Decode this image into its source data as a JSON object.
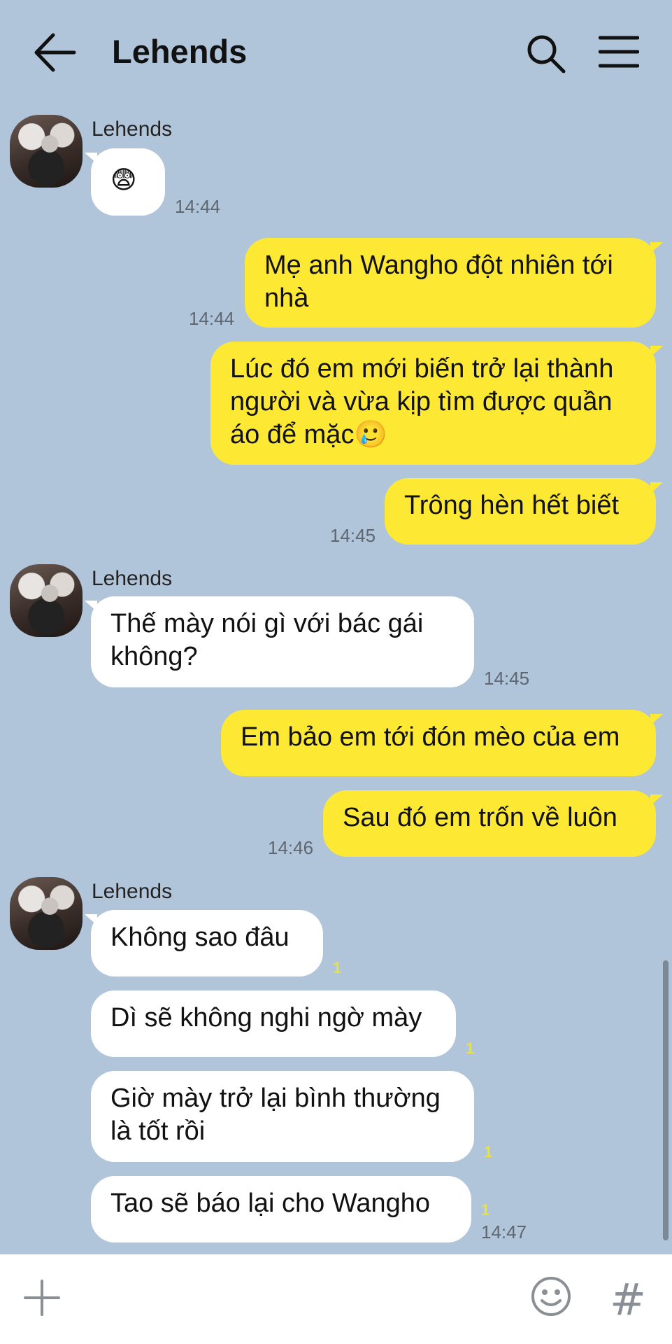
{
  "header": {
    "title": "Lehends",
    "back_icon": "arrow-left-icon",
    "search_icon": "search-icon",
    "menu_icon": "menu-icon"
  },
  "messages": [
    {
      "sender": "Lehends",
      "text": "😨",
      "time": "14:44"
    },
    {
      "text": "Mẹ anh Wangho đột nhiên tới nhà",
      "time": "14:44"
    },
    {
      "text": "Lúc đó em mới biến trở lại thành người và vừa kịp tìm được quần áo để mặc🥲"
    },
    {
      "text": "Trông hèn hết biết",
      "time": "14:45"
    },
    {
      "sender": "Lehends",
      "text": "Thế mày nói gì với bác gái không?",
      "time": "14:45"
    },
    {
      "text": "Em bảo em tới đón mèo của em"
    },
    {
      "text": "Sau đó em trốn về luôn",
      "time": "14:46"
    },
    {
      "sender": "Lehends",
      "text": "Không sao đâu",
      "unread": "1"
    },
    {
      "text": "Dì sẽ không nghi ngờ mày",
      "unread": "1"
    },
    {
      "text": "Giờ mày trở lại bình thường là tốt rồi",
      "unread": "1"
    },
    {
      "text": "Tao sẽ báo lại cho Wangho",
      "unread": "1",
      "time": "14:47"
    }
  ],
  "input_bar": {
    "plus_icon": "plus-icon",
    "emoji_icon": "emoji-icon",
    "hashtag": "#"
  },
  "colors": {
    "background": "#b1c5da",
    "outgoing": "#fde934",
    "incoming": "#ffffff",
    "unread": "#e8e23a"
  }
}
